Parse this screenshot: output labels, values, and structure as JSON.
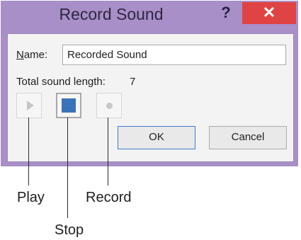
{
  "dialog": {
    "title": "Record Sound",
    "help_label": "?",
    "close_label": "✕",
    "name_label_accel": "N",
    "name_label_rest": "ame:",
    "name_value": "Recorded Sound",
    "length_label": "Total sound length:",
    "length_value": "7",
    "ok_label": "OK",
    "cancel_label": "Cancel"
  },
  "callouts": {
    "play": "Play",
    "stop": "Stop",
    "record": "Record"
  },
  "colors": {
    "frame": "#a88fc8",
    "close": "#e04343",
    "stop_icon": "#3b73b9"
  },
  "icons": [
    "play-icon",
    "stop-icon",
    "record-icon",
    "close-icon",
    "help-icon"
  ]
}
